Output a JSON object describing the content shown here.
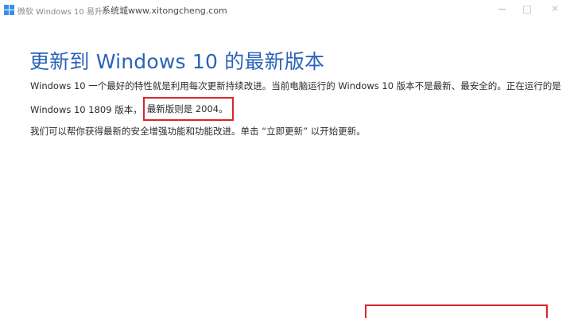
{
  "window": {
    "title": "微软 Windows 10 易升",
    "watermark": "系统城www.xitongcheng.com"
  },
  "content": {
    "heading": "更新到 Windows 10 的最新版本",
    "para1_line1": "Windows 10 一个最好的特性就是利用每次更新持续改进。当前电脑运行的 Windows 10 版本不是最新、最安全的。正在运行的是",
    "para1_line2_prefix": "Windows 10 1809 版本，",
    "para1_line2_highlight": "最新版则是 2004。",
    "para2": "我们可以帮你获得最新的安全增强功能和功能改进。单击 “立即更新” 以开始更新。"
  },
  "colors": {
    "heading": "#2b63b8",
    "highlight_border": "#d8252c",
    "body_text": "#2a2a2a"
  },
  "icons": {
    "app": "windows-logo-icon",
    "minimize": "minimize-icon",
    "maximize": "maximize-icon",
    "close": "close-icon"
  }
}
